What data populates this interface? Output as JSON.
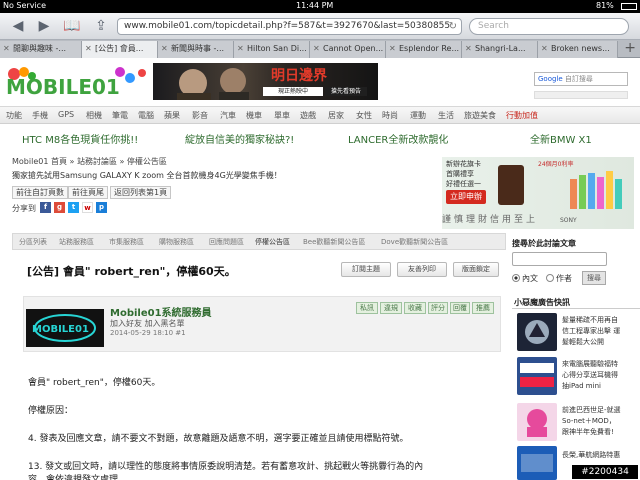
{
  "status": {
    "carrier": "No Service",
    "time": "11:44 PM",
    "battery": "81%"
  },
  "browser": {
    "url": "www.mobile01.com/topicdetail.php?f=587&t=3927670&last=50380855",
    "search_placeholder": "Search",
    "tabs": [
      {
        "label": "閒聊與趣味 -..."
      },
      {
        "label": "[公告] 會員..."
      },
      {
        "label": "新聞與時事 -..."
      },
      {
        "label": "Hilton San Di..."
      },
      {
        "label": "Cannot Open..."
      },
      {
        "label": "Esplendor Re..."
      },
      {
        "label": "Shangri-La..."
      },
      {
        "label": "Broken news..."
      }
    ]
  },
  "header": {
    "logo_text": "MOBILE01",
    "banner_title": "明日邊界",
    "banner_sub1": "現正熱映中",
    "banner_sub2": "搶先看預告",
    "google_search_label": "自訂搜尋"
  },
  "nav": [
    "功能",
    "手機",
    "GPS",
    "相機",
    "筆電",
    "電腦",
    "蘋果",
    "影音",
    "汽車",
    "機車",
    "單車",
    "遊戲",
    "居家",
    "女性",
    "時尚",
    "運動",
    "生活",
    "旅遊美食",
    "行動加值"
  ],
  "promos": [
    "HTC M8各色現貨任你挑!!",
    "綻放自信美的獨家秘訣?!",
    "LANCER全新改款靚化",
    "全新BMW X1"
  ],
  "breadcrumb": "Mobile01 首頁 » 站務討論區 » 停權公告區",
  "notice": "獨家搶先試用Samsung GALAXY K zoom 全台首款機身4G光學變焦手機！",
  "page_buttons": [
    "前往自訂頁數",
    "前往頁尾",
    "返回列表第1頁"
  ],
  "share_label": "分享到",
  "right_ad": {
    "l1": "新辦花旗卡",
    "l2": "首購禮享",
    "l3": "好禮任選一",
    "cta": "立即申辦",
    "top": "24個月0利率",
    "brand": "SONY",
    "tagline": "謹慎理財信用至上"
  },
  "forum_tabs": [
    "分區列表",
    "站務服務區",
    "市集服務區",
    "購物服務區",
    "回應問題區",
    "停權公告區",
    "Bee歡聽新聞公告區",
    "Dove歡聽新聞公告區"
  ],
  "thread": {
    "title": "[公告] 會員\" robert_ren\"，停權60天。",
    "actions": [
      "訂閱主題",
      "友善列印",
      "版面鎖定"
    ]
  },
  "post": {
    "author": "Mobile01系統服務員",
    "links": "加入好友  加入黑名單",
    "date": "2014-05-29 18:10  #1",
    "buttons": [
      "私訊",
      "違規",
      "收藏",
      "評分",
      "回覆",
      "推薦"
    ],
    "body": [
      "會員\" robert_ren\"，停權60天。",
      "停權原因：",
      "4. 發表及回應文章，請不要文不對題，故意離題及語意不明，選字要正確並且請使用標點符號。",
      "13. 發文或回文時，請以理性的態度將事情原委說明清楚。若有蓄意攻計、挑起戰火等挑釁行為的內",
      "容，會依違規發文處理。"
    ]
  },
  "sidebar": {
    "search_title": "搜尋於此討論文章",
    "radio_content": "內文",
    "radio_author": "作者",
    "search_button": "搜尋",
    "news_title": "小惡魔廣告快訊",
    "news": [
      {
        "l1": "髮量稀疏不用再自",
        "l2": "信工程專家出擊 運",
        "l3": "髮輕鬆大公開"
      },
      {
        "l1": "來電腦展聽驗福特",
        "l2": "心得分享送耳機得",
        "l3": "抽iPad mini"
      },
      {
        "l1": "前進巴西世足-就選",
        "l2": "So-net＋MOD，",
        "l3": "跟神半年免費看!"
      },
      {
        "l1": "長榮,華航網路特惠",
        "l2": "",
        "l3": ""
      }
    ]
  },
  "watermark": "#2200434"
}
